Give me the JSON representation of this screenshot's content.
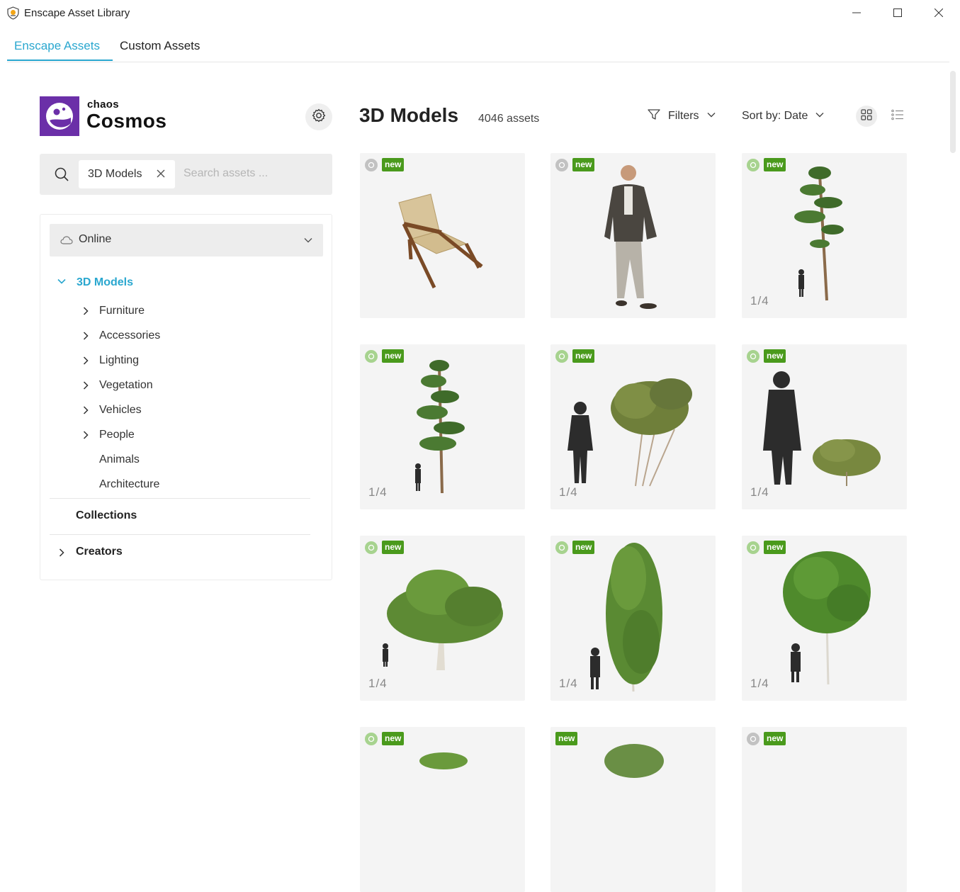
{
  "window": {
    "title": "Enscape Asset Library",
    "controls": {
      "minimize": "—",
      "maximize": "☐",
      "close": "✕"
    }
  },
  "tabs": [
    {
      "label": "Enscape Assets",
      "active": true
    },
    {
      "label": "Custom Assets",
      "active": false
    }
  ],
  "brand": {
    "line1": "chaos",
    "line2": "Cosmos",
    "color": "#6b2fa8"
  },
  "search": {
    "chip_label": "3D Models",
    "placeholder": "Search assets ..."
  },
  "source": {
    "selected": "Online",
    "icon": "cloud-icon"
  },
  "tree": {
    "root": "3D Models",
    "items": [
      {
        "label": "Furniture",
        "expandable": true
      },
      {
        "label": "Accessories",
        "expandable": true
      },
      {
        "label": "Lighting",
        "expandable": true
      },
      {
        "label": "Vegetation",
        "expandable": true
      },
      {
        "label": "Vehicles",
        "expandable": true
      },
      {
        "label": "People",
        "expandable": true
      },
      {
        "label": "Animals",
        "expandable": false
      },
      {
        "label": "Architecture",
        "expandable": false
      }
    ],
    "collections": "Collections",
    "creators": "Creators"
  },
  "main": {
    "title": "3D Models",
    "count": "4046 assets",
    "filters_label": "Filters",
    "sort_label": "Sort by: Date",
    "view": "grid"
  },
  "cards": [
    {
      "badge": "new",
      "source": "grey",
      "counter": "",
      "art": "chair"
    },
    {
      "badge": "new",
      "source": "grey",
      "counter": "",
      "art": "man"
    },
    {
      "badge": "new",
      "source": "green",
      "counter": "1/4",
      "art": "pine-tall"
    },
    {
      "badge": "new",
      "source": "green",
      "counter": "1/4",
      "art": "pine"
    },
    {
      "badge": "new",
      "source": "green",
      "counter": "1/4",
      "art": "shrub-tall"
    },
    {
      "badge": "new",
      "source": "green",
      "counter": "1/4",
      "art": "bush"
    },
    {
      "badge": "new",
      "source": "green",
      "counter": "1/4",
      "art": "tree-wide"
    },
    {
      "badge": "new",
      "source": "green",
      "counter": "1/4",
      "art": "tree-column"
    },
    {
      "badge": "new",
      "source": "green",
      "counter": "1/4",
      "art": "tree-round"
    },
    {
      "badge": "new",
      "source": "green",
      "counter": "",
      "art": "partial-bush"
    },
    {
      "badge": "new",
      "source": "none",
      "counter": "",
      "art": "partial-round"
    },
    {
      "badge": "new",
      "source": "grey",
      "counter": "",
      "art": "empty"
    }
  ],
  "colors": {
    "accent": "#2aa7cf",
    "badge": "#4a9a1c",
    "card_bg": "#f4f4f4"
  }
}
